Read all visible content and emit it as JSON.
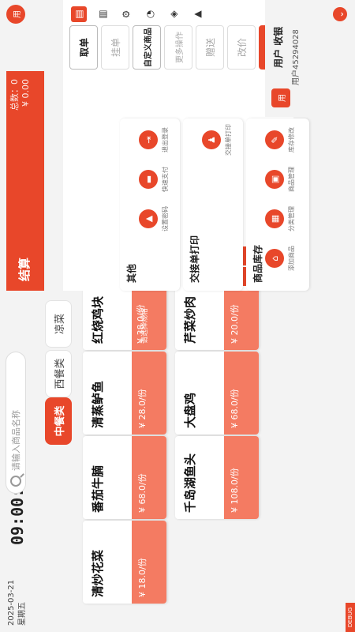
{
  "clock": {
    "time": "09:00:59",
    "date": "2025-03-21",
    "weekday": "星期五"
  },
  "search": {
    "placeholder": "请输入商品名称"
  },
  "categories": [
    {
      "label": "中餐类",
      "active": true
    },
    {
      "label": "西餐类",
      "active": false
    },
    {
      "label": "凉菜",
      "active": false
    }
  ],
  "dishes": [
    {
      "name": "红烧鸡块",
      "price": "¥ 38.0/份",
      "status": "请选择规格"
    },
    {
      "name": "清蒸鲈鱼",
      "price": "¥ 28.0/份",
      "status": ""
    },
    {
      "name": "番茄牛腩",
      "price": "¥ 68.0/份",
      "status": ""
    },
    {
      "name": "清炒花菜",
      "price": "¥ 18.0/份",
      "status": ""
    },
    {
      "name": "芹菜炒肉",
      "price": "¥ 20.0/份",
      "status": ""
    },
    {
      "name": "大盘鸡",
      "price": "¥ 68.0/份",
      "status": ""
    },
    {
      "name": "千岛湖鱼头",
      "price": "¥ 108.0/份",
      "status": ""
    }
  ],
  "order": {
    "quantity": "1",
    "buttons": {
      "clear": "清空",
      "plus": "+",
      "minus": "-",
      "change_price": "改价",
      "gift": "赠送",
      "more": "更多操作",
      "custom": "自定义商品",
      "hang": "挂单",
      "take": "取单"
    },
    "total_count": "总数：0",
    "total_amount": "¥ 0.00",
    "checkout": "结算"
  },
  "groups": {
    "inventory": {
      "title": "商品库存",
      "items": [
        "库存修改",
        "商品管理",
        "分类管理",
        "添加商品"
      ]
    },
    "shift": {
      "title": "交接单打印",
      "items": [
        "交接单打印"
      ]
    },
    "other": {
      "title": "其他",
      "items": [
        "退出登录",
        "快速支付",
        "设置密码"
      ]
    }
  },
  "user": {
    "avatar": "用",
    "name": "用户",
    "mode": "收银",
    "account": "用户45294028"
  },
  "toolbar": {
    "avatar": "用"
  },
  "corner_badge": "DEBUG",
  "colors": {
    "accent": "#e8472a",
    "price_bg": "#f47b62"
  }
}
